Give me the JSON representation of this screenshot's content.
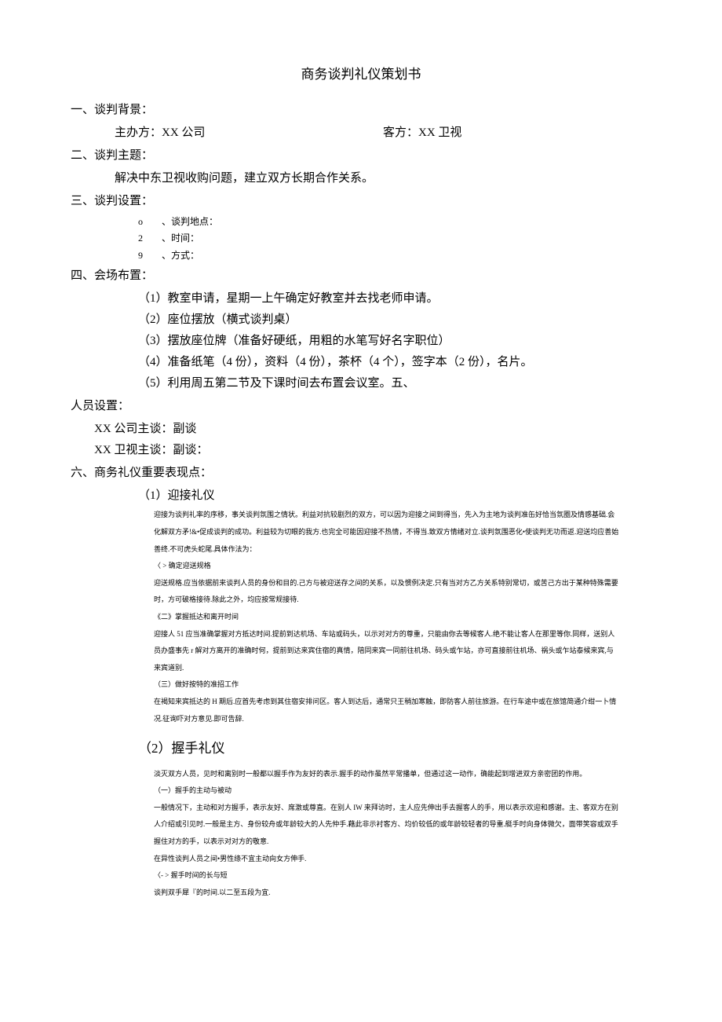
{
  "title": "商务谈判礼仪策划书",
  "sections": {
    "s1": {
      "heading": "一、谈判背景：",
      "host_label": "主办方：XX 公司",
      "guest_label": "客方：XX 卫视"
    },
    "s2": {
      "heading": "二、谈判主题：",
      "content": "解决中东卫视收购问题，建立双方长期合作关系。"
    },
    "s3": {
      "heading": "三、谈判设置：",
      "items": [
        {
          "num": "o",
          "label": "、谈判地点："
        },
        {
          "num": "2",
          "label": "、时间："
        },
        {
          "num": "9",
          "label": "、方式："
        }
      ]
    },
    "s4": {
      "heading": "四、会场布置：",
      "items": [
        "（1）教室申请，星期一上午确定好教室并去找老师申请。",
        "（2）座位摆放（横式谈判桌）",
        "（3）摆放座位牌（准备好硬纸，用粗的水笔写好名字职位）",
        "（4）准备纸笔（4 份），资料（4 份），茶杯（4 个），签字本（2 份），名片。",
        "（5）利用周五第二节及下课时间去布置会议室。五、"
      ]
    },
    "s5": {
      "heading": "人员设置：",
      "lines": [
        "XX 公司主谈：副谈",
        "XX 卫视主谈：副谈："
      ]
    },
    "s6": {
      "heading": "六、商务礼仪重要表现点：",
      "p1": {
        "title": "（1）迎接礼仪",
        "paras": [
          "迎接为谈判礼率的序移，事关谈判氛围之情状。利益对抗较剧烈的双方，可以因为迎接之间到得当，先入为主地为谈判准缶好恰当氛圈及情感基础.会化解双方矛!&•促成谈判的成功。利益较为切眼的我方.也完全可能因迎接不热情，不得当.致双方情绪对立.谈判氛围恶化•使谈判无功而返.迎送均应善始善终.不可虎头蛇尾.具体作法为：",
          "〈 > 确定迎送规格",
          "迎送规格.应当依据前来谈判人员的身份和目的.己方与被迎送存之间的关系，以及惯例决定.只有当对方乙方关系特别常切，或苦己方出于某种特殊需要时，方可破格接待.除此之外，均应按常规接待.",
          "《二》掌握抵达和离开时间",
          "迎接人 51 应当准确掌握对方抵达时间.提前到达机场、车站或码头，以示对对方的尊重，只能由你去等候客人.绝不能让客人在那里等你.同样，送别人员办盛事先 r 解对方离开的准确时何，提前到达来宾住宿的真情，陪同来宾一同前往机场、码头或乍站，亦可直接前往机场、祸头或乍站泰候来宾,与来宾道别.",
          "（三）做好按特的准招工作",
          "在褐知来宾抵达的 H 期后.应首先考虑到其住宿安排问区。客人到达后，通常只王稍加寒触，即防客人前往旅游。在行车途中或在旅馆简通介绀一卜情况.征询吓对方意见.即可告辞."
        ]
      },
      "p2": {
        "title": "（2）握手礼仪",
        "paras": [
          "淡灭双方人员，见时和离别时一般都以握手作为友好的表示.握手的动作虽然平常播单，但通过这一动作，确能起到增进双方亲密团的作用。",
          "（一）握手的主动与被动",
          "一般情况下，主动和对方握手，表示友好、席激或尊直。在别人 IW 来拜访时，主人应先伸出手去握客人的手，用以表示欢迎和感谢。主、客双方在别人介绍或引见时.一般是主方、身份较舟或年龄较大的人先仲手.藉此非示衬客方、均价较低的或年龄较轻者的导重.艇手时向身体微欠，面带笑容或双手握住对方的手，以表示对对方的敬意.",
          "在异性谈判人员之间•男性绦不宜主动向女方伸手.",
          "〈- > 握手时间的长与短",
          "谈判双手犀『的时间.以二至五段为宜."
        ]
      }
    }
  }
}
